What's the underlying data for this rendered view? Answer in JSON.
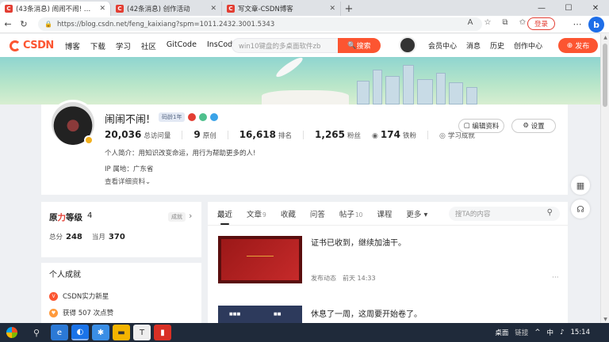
{
  "browser": {
    "tabs": [
      {
        "title": "(43条消息) 闹闹不闹! 的博客_CS",
        "active": true
      },
      {
        "title": "(42条消息) 创作活动",
        "active": false
      },
      {
        "title": "写文章-CSDN博客",
        "active": false
      }
    ],
    "url": "https://blog.csdn.net/feng_kaixiang?spm=1011.2432.3001.5343",
    "login_label": "登录",
    "bing_label": "b"
  },
  "header": {
    "logo": "CSDN",
    "nav": [
      "博客",
      "下载",
      "学习",
      "社区",
      "GitCode",
      "InsCode"
    ],
    "search_placeholder": "win10键盘的多桌面软件zb",
    "search_button": "搜索",
    "links": [
      "会员中心",
      "消息",
      "历史",
      "创作中心"
    ],
    "publish_button": "发布"
  },
  "profile": {
    "nickname": "闹闹不闹!",
    "level_badge": "码龄1年",
    "stats": [
      {
        "value": "20,036",
        "label": "总访问量"
      },
      {
        "value": "9",
        "label": "原创"
      },
      {
        "value": "16,618",
        "label": "排名"
      },
      {
        "value": "1,265",
        "label": "粉丝"
      },
      {
        "value": "174",
        "label": "铁粉"
      }
    ],
    "study_label": "学习成就",
    "bio": "个人简介：用知识改变命运，用行为帮助更多的人!",
    "ip": "IP 属地：广东省",
    "detail_link": "查看详细资料",
    "edit_button": "编辑资料",
    "settings_button": "设置"
  },
  "level_card": {
    "title_prefix": "原",
    "title_accent": "力",
    "title_suffix": "等级",
    "level": "4",
    "tag": "成就",
    "total_label": "总分",
    "total_value": "248",
    "month_label": "当月",
    "month_value": "370"
  },
  "achievements": {
    "title": "个人成就",
    "items": [
      "CSDN实力新星",
      "获得 507 次点赞"
    ]
  },
  "feed": {
    "tabs": [
      {
        "label": "最近",
        "count": ""
      },
      {
        "label": "文章",
        "count": "9"
      },
      {
        "label": "收藏",
        "count": ""
      },
      {
        "label": "问答",
        "count": ""
      },
      {
        "label": "帖子",
        "count": "10"
      },
      {
        "label": "课程",
        "count": ""
      },
      {
        "label": "更多",
        "count": ""
      }
    ],
    "search_placeholder": "搜TA的内容",
    "posts": [
      {
        "text": "证书已收到，继续加油干。",
        "meta_type": "发布动态",
        "meta_time": "前天 14:33",
        "more": "···"
      },
      {
        "text": "休息了一周，这周要开始卷了。"
      }
    ]
  },
  "taskbar": {
    "tray": [
      "桌面",
      "链接",
      "中",
      "15:14"
    ]
  }
}
